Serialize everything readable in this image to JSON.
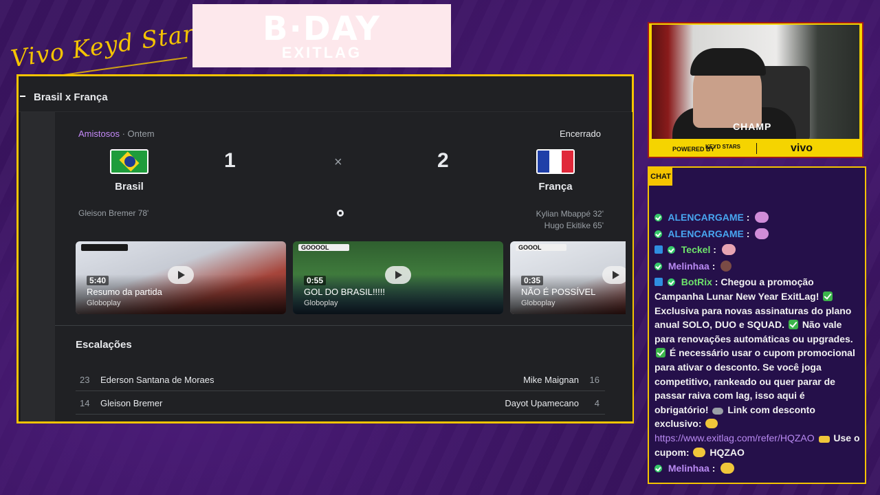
{
  "overlay": {
    "brand_script": "Vivo Keyd Stars",
    "banner_big": "B·DAY",
    "banner_small": "EXITLAG"
  },
  "browser": {
    "page_title": "Brasil x França"
  },
  "match": {
    "competition": "Amistosos",
    "when": "· Ontem",
    "status": "Encerrado",
    "home": {
      "name": "Brasil",
      "score": "1",
      "flag": "brazil-flag"
    },
    "away": {
      "name": "França",
      "score": "2",
      "flag": "france-flag"
    },
    "separator": "×",
    "scorers_home": [
      "Gleison Bremer 78'"
    ],
    "scorers_away": [
      "Kylian Mbappé 32'",
      "Hugo Ekitike 65'"
    ]
  },
  "videos": [
    {
      "duration": "5:40",
      "title": "Resumo da partida",
      "source": "Globoplay"
    },
    {
      "duration": "0:55",
      "title": "GOL DO BRASIL!!!!!",
      "source": "Globoplay",
      "hud": "GOOOOL"
    },
    {
      "duration": "0:35",
      "title": "NÃO É POSSÍVEL",
      "source": "Globoplay",
      "hud": "GOOOL"
    }
  ],
  "lineups": {
    "title": "Escalações",
    "rows": [
      {
        "home_num": "23",
        "home_name": "Ederson Santana de Moraes",
        "away_name": "Mike Maignan",
        "away_num": "16"
      },
      {
        "home_num": "14",
        "home_name": "Gleison Bremer",
        "away_name": "Dayot Upamecano",
        "away_num": "4"
      }
    ]
  },
  "webcam": {
    "overlay_logo": "CHAMP",
    "powered_by": "POWERED BY",
    "sponsor_keyd": "KEYD STARS",
    "sponsor_vivo": "vivo"
  },
  "chat": {
    "tab_label": "CHAT",
    "messages": [
      {
        "user": "ALENCARGAME",
        "text": ":"
      },
      {
        "user": "ALENCARGAME",
        "text": ":"
      },
      {
        "user": "Teckel",
        "text": ":"
      },
      {
        "user": "Melinhaa",
        "text": ":"
      },
      {
        "user": "BotRix",
        "text_1": ": Chegou a promoção Campanha Lunar New Year ExitLag!",
        "text_2": "Exclusiva para novas assinaturas do plano anual SOLO, DUO e SQUAD.",
        "text_3": "Não vale para renovações automáticas ou upgrades.",
        "text_4": "É necessário usar o cupom promocional para ativar o desconto. Se você joga competitivo, rankeado ou quer parar de passar raiva com lag, isso aqui é obrigatório!",
        "text_5": "Link com desconto exclusivo:",
        "link": "https://www.exitlag.com/refer/HQZAO",
        "text_6": "Use o cupom:",
        "coupon": "HQZAO"
      },
      {
        "user": "Melinhaa",
        "text": ":"
      }
    ]
  },
  "colors": {
    "frame_accent": "#f5c400",
    "background": "#3a1460",
    "competition": "#c58af9"
  }
}
